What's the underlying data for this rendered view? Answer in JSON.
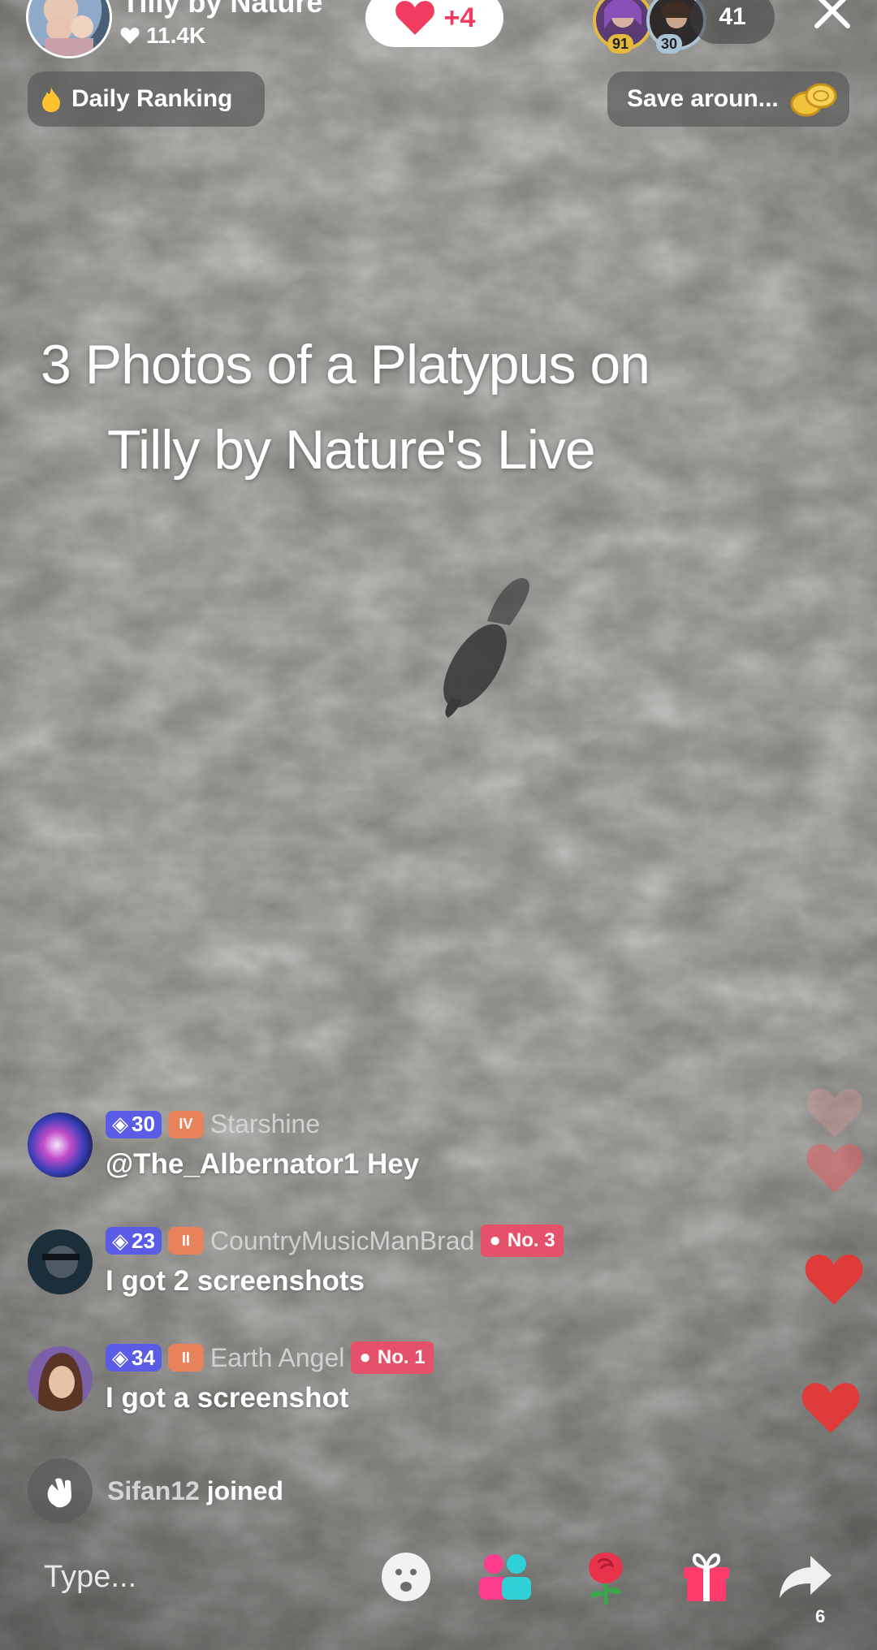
{
  "header": {
    "host_name": "Tilly by Nature",
    "host_likes": "11.4K",
    "like_pill_count": "+4",
    "viewers": [
      {
        "badge": "91",
        "badge_color": "#e5b93e"
      },
      {
        "badge": "30",
        "badge_color": "#a9c4d6"
      }
    ],
    "viewer_count": "41"
  },
  "chips": {
    "daily_ranking": "Daily Ranking",
    "save_around": "Save aroun..."
  },
  "overlay_title": {
    "line1": "3 Photos of a Platypus on",
    "line2": "Tilly by Nature's Live"
  },
  "comments": [
    {
      "level": "30",
      "sub_badge": "IV",
      "username": "Starshine",
      "text": "@The_Albernator1 Hey",
      "rank": ""
    },
    {
      "level": "23",
      "sub_badge": "II",
      "username": "CountryMusicManBrad",
      "text": "I got 2 screenshots",
      "rank": "No. 3"
    },
    {
      "level": "34",
      "sub_badge": "II",
      "username": "Earth Angel",
      "text": "I got a screenshot",
      "rank": "No. 1"
    }
  ],
  "join_notice": {
    "username": "Sifan12",
    "action": "joined"
  },
  "bottom_bar": {
    "placeholder": "Type...",
    "share_count": "6"
  },
  "colors": {
    "heart": "#f03d5f",
    "level_badge": "#5b5ce6",
    "rank_badge": "#e5506a",
    "gift": "#ff3b6b",
    "multi_guest_pink": "#ff3b8d",
    "multi_guest_teal": "#2fd0d8"
  },
  "icons": [
    "heart-icon",
    "fire-icon",
    "coins-icon",
    "close-icon",
    "gem-icon",
    "wave-icon",
    "emoji-icon",
    "multi-guest-icon",
    "rose-icon",
    "gift-icon",
    "share-icon"
  ]
}
